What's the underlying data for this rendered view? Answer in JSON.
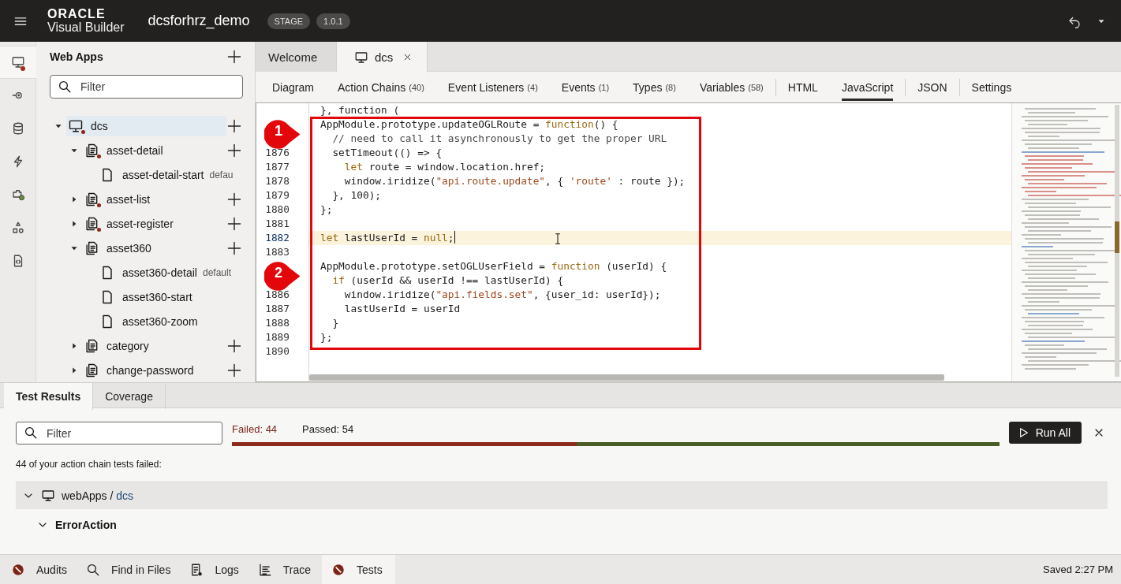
{
  "header": {
    "logo_top": "ORACLE",
    "logo_bottom": "Visual Builder",
    "app_name": "dcsforhrz_demo",
    "badges": [
      "STAGE",
      "1.0.1"
    ]
  },
  "rail": [
    {
      "kind": "monitor",
      "selected": true,
      "error": true
    },
    {
      "kind": "service",
      "selected": false
    },
    {
      "kind": "database",
      "selected": false
    },
    {
      "kind": "bolt",
      "selected": false
    },
    {
      "kind": "component",
      "selected": false
    },
    {
      "kind": "hierarchy",
      "selected": false
    },
    {
      "kind": "code",
      "selected": false
    }
  ],
  "nav": {
    "title": "Web Apps",
    "filter": {
      "placeholder": "Filter"
    },
    "tree": [
      {
        "label": "dcs",
        "kind": "app",
        "error": true,
        "selected": true,
        "expanded": true,
        "children": [
          {
            "label": "asset-detail",
            "kind": "flow",
            "error": true,
            "selected": false,
            "expanded": true,
            "children": [
              {
                "label": "asset-detail-start",
                "kind": "page",
                "selected": false,
                "tag": "defau"
              }
            ]
          },
          {
            "label": "asset-list",
            "kind": "flow",
            "error": true,
            "selected": false,
            "expanded": false
          },
          {
            "label": "asset-register",
            "kind": "flow",
            "error": true,
            "selected": false,
            "expanded": false
          },
          {
            "label": "asset360",
            "kind": "flow",
            "selected": false,
            "expanded": true,
            "children": [
              {
                "label": "asset360-detail",
                "kind": "page",
                "selected": false,
                "tag": "default"
              },
              {
                "label": "asset360-start",
                "kind": "page",
                "selected": false
              },
              {
                "label": "asset360-zoom",
                "kind": "page",
                "selected": false
              }
            ]
          },
          {
            "label": "category",
            "kind": "flow",
            "selected": false,
            "expanded": false
          },
          {
            "label": "change-password",
            "kind": "flow",
            "selected": false,
            "expanded": false
          }
        ]
      }
    ]
  },
  "editor": {
    "tabs": [
      {
        "label": "Welcome",
        "selected": false
      },
      {
        "label": "dcs",
        "selected": true,
        "closable": true
      }
    ],
    "subtabs": [
      {
        "label": "Diagram",
        "selected": false
      },
      {
        "label": "Action Chains",
        "count": "(40)",
        "selected": false
      },
      {
        "label": "Event Listeners",
        "count": "(4)",
        "selected": false
      },
      {
        "label": "Events",
        "count": "(1)",
        "selected": false
      },
      {
        "label": "Types",
        "count": "(8)",
        "selected": false
      },
      {
        "label": "Variables",
        "count": "(58)",
        "selected": false
      },
      {
        "label": "HTML",
        "selected": false,
        "divider_before": true
      },
      {
        "label": "JavaScript",
        "selected": true
      },
      {
        "label": "JSON",
        "selected": false,
        "divider_before": true
      },
      {
        "label": "Settings",
        "selected": false,
        "divider_before": true
      }
    ],
    "lines": [
      {
        "tokens": [
          {
            "kind": "plain",
            "text": "}, function ("
          }
        ]
      },
      {
        "frame_start": true,
        "callout": "1",
        "tokens": [
          {
            "kind": "plain",
            "text": "AppModule.prototype.updateOGLRoute = "
          },
          {
            "kind": "keyword",
            "text": "function"
          },
          {
            "kind": "plain",
            "text": "() {"
          }
        ]
      },
      {
        "tokens": [
          {
            "kind": "comment",
            "text": "  // need to call it asynchronously to get the proper URL"
          }
        ]
      },
      {
        "num": "1876",
        "tokens": [
          {
            "kind": "plain",
            "text": "  setTimeout(() => {"
          }
        ]
      },
      {
        "num": "1877",
        "tokens": [
          {
            "kind": "keyword",
            "text": "    let"
          },
          {
            "kind": "plain",
            "text": " route = window.location.href;"
          }
        ]
      },
      {
        "num": "1878",
        "tokens": [
          {
            "kind": "plain",
            "text": "    window.iridize("
          },
          {
            "kind": "string",
            "text": "\"api.route.update\""
          },
          {
            "kind": "plain",
            "text": ", { "
          },
          {
            "kind": "string",
            "text": "'route'"
          },
          {
            "kind": "plain",
            "text": " : route });"
          }
        ]
      },
      {
        "num": "1879",
        "tokens": [
          {
            "kind": "plain",
            "text": "  }, 100);"
          }
        ]
      },
      {
        "num": "1880",
        "tokens": [
          {
            "kind": "plain",
            "text": "};"
          }
        ]
      },
      {
        "num": "1881"
      },
      {
        "num": "1882",
        "current": true,
        "tokens": [
          {
            "kind": "keyword",
            "text": "let"
          },
          {
            "kind": "plain",
            "text": " lastUserId = "
          },
          {
            "kind": "keyword",
            "text": "null"
          },
          {
            "kind": "plain",
            "text": ";"
          }
        ]
      },
      {
        "num": "1883"
      },
      {
        "callout": "2",
        "tokens": [
          {
            "kind": "plain",
            "text": "AppModule.prototype.setOGLUserField = "
          },
          {
            "kind": "keyword",
            "text": "function"
          },
          {
            "kind": "plain",
            "text": " (userId) {"
          }
        ]
      },
      {
        "tokens": [
          {
            "kind": "keyword",
            "text": "  if"
          },
          {
            "kind": "plain",
            "text": " (userId && userId !== lastUserId) {"
          }
        ]
      },
      {
        "num": "1886",
        "tokens": [
          {
            "kind": "plain",
            "text": "    window.iridize("
          },
          {
            "kind": "string",
            "text": "\"api.fields.set\""
          },
          {
            "kind": "plain",
            "text": ", {user_id: userId});"
          }
        ]
      },
      {
        "num": "1887",
        "tokens": [
          {
            "kind": "plain",
            "text": "    lastUserId = userId"
          }
        ]
      },
      {
        "num": "1888",
        "tokens": [
          {
            "kind": "plain",
            "text": "  }"
          }
        ]
      },
      {
        "num": "1889",
        "frame_end": true,
        "tokens": [
          {
            "kind": "plain",
            "text": "};"
          }
        ]
      },
      {
        "num": "1890"
      }
    ]
  },
  "tests": {
    "tabs": [
      {
        "label": "Test Results",
        "selected": true
      },
      {
        "label": "Coverage",
        "selected": false
      }
    ],
    "filter": {
      "placeholder": "Filter"
    },
    "failed": "Failed: 44",
    "passed": "Passed: 54",
    "level": 0.449,
    "run_button": "Run All",
    "message": "44 of your action chain tests failed:",
    "results": [
      {
        "label": "webApps / ",
        "link": "dcs",
        "expanded": true,
        "children": [
          {
            "label": "ErrorAction",
            "expanded": true
          }
        ]
      }
    ]
  },
  "status": {
    "items": [
      {
        "label": "Audits",
        "kind": "error",
        "selected": false
      },
      {
        "label": "Find in Files",
        "kind": "search",
        "selected": false
      },
      {
        "label": "Logs",
        "kind": "logs",
        "selected": false
      },
      {
        "label": "Trace",
        "kind": "trace",
        "selected": false
      },
      {
        "label": "Tests",
        "kind": "error",
        "selected": true
      }
    ],
    "saved": "Saved 2:27 PM"
  }
}
